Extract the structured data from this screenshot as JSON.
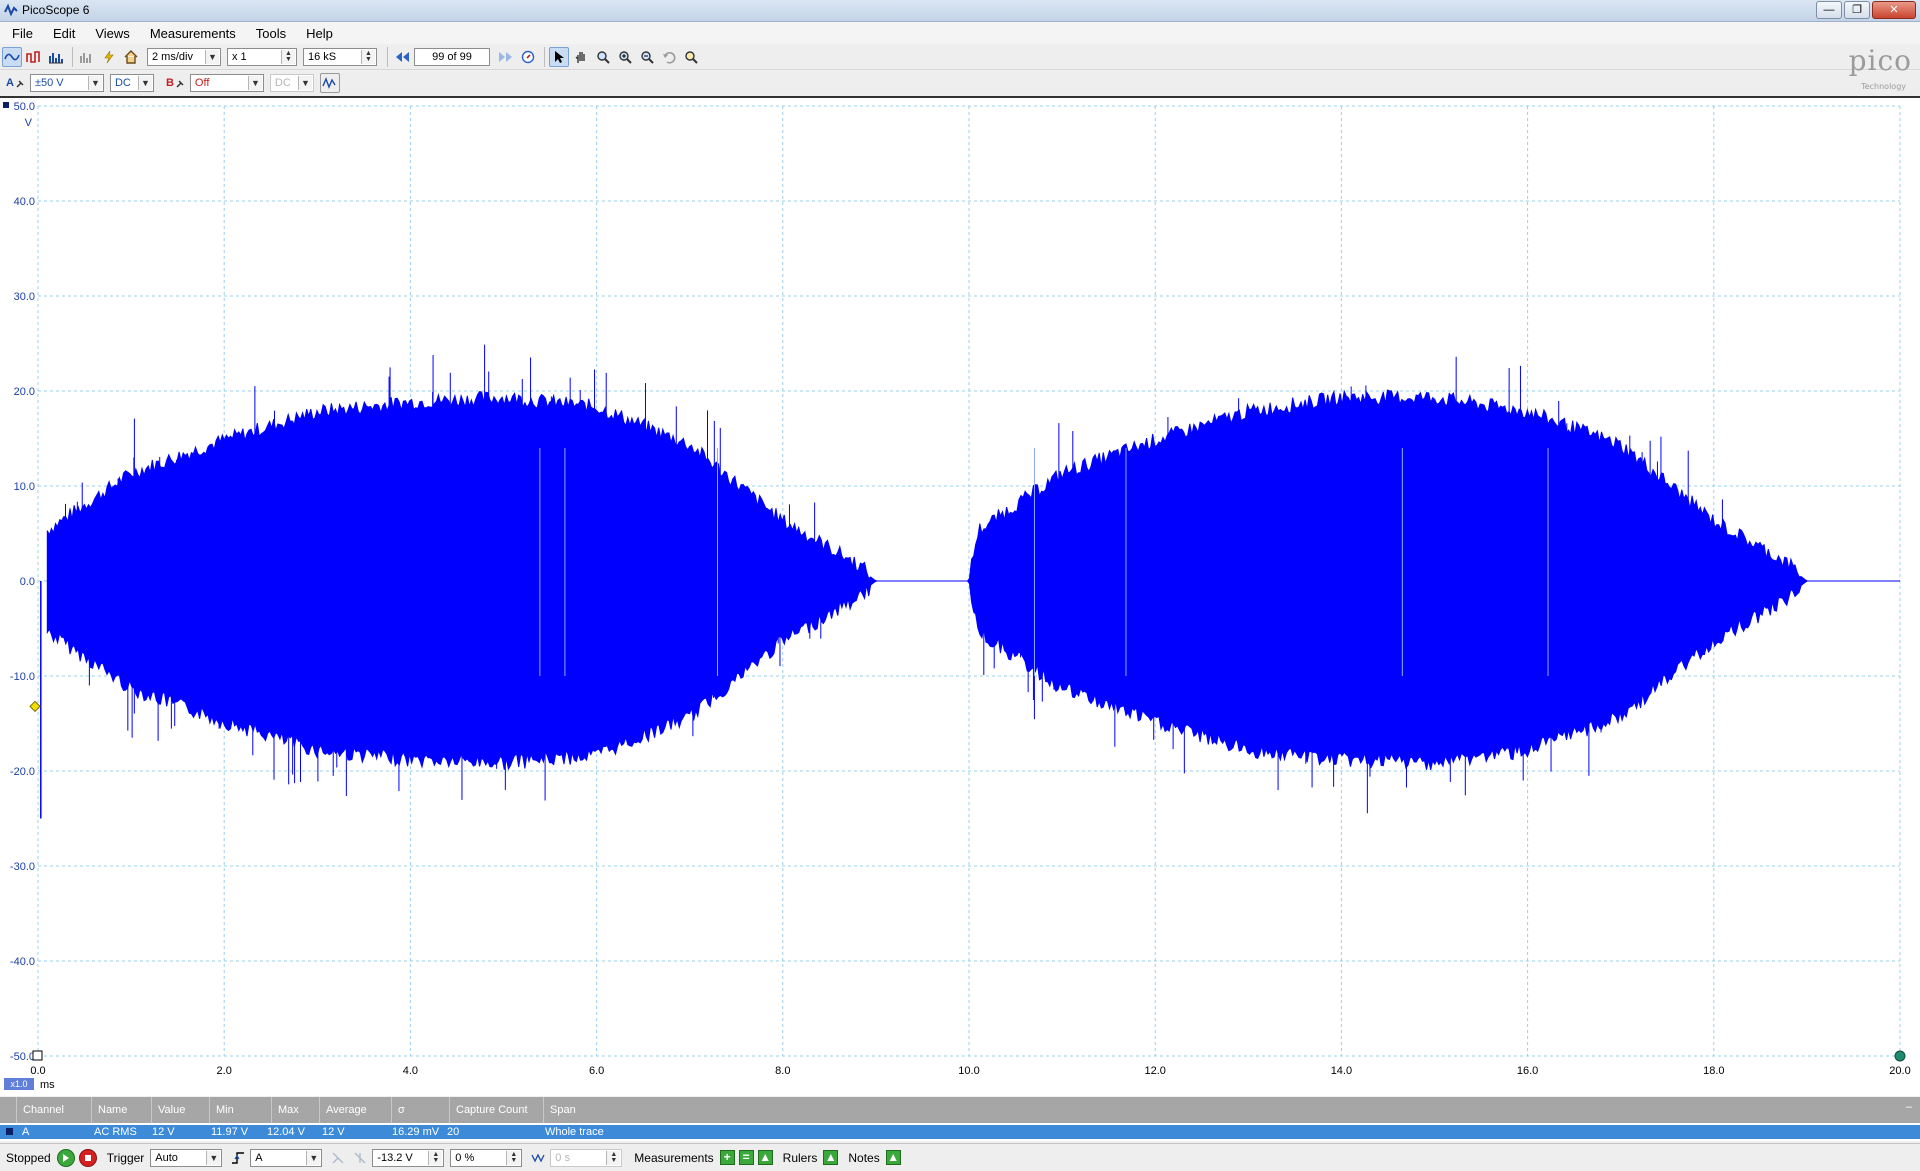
{
  "window": {
    "title": "PicoScope 6"
  },
  "menu": [
    "File",
    "Edit",
    "Views",
    "Measurements",
    "Tools",
    "Help"
  ],
  "toolbar": {
    "timebase": "2 ms/div",
    "zoom": "x 1",
    "samples": "16 kS",
    "buffer": "99 of 99"
  },
  "channels": {
    "a_label": "A",
    "a_range": "±50 V",
    "a_coupling": "DC",
    "b_label": "B",
    "b_range": "Off",
    "b_coupling": "DC"
  },
  "logo": {
    "name": "pico",
    "sub": "Technology"
  },
  "scope": {
    "y_unit": "V",
    "x_unit": "ms",
    "zoom_badge": "x1.0",
    "y_ticks": [
      "50.0",
      "40.0",
      "30.0",
      "20.0",
      "10.0",
      "0.0",
      "-10.0",
      "-20.0",
      "-30.0",
      "-40.0",
      "-50.0"
    ],
    "x_ticks": [
      "0.0",
      "2.0",
      "4.0",
      "6.0",
      "8.0",
      "10.0",
      "12.0",
      "14.0",
      "16.0",
      "18.0",
      "20.0"
    ],
    "trace_color": "#0000ff",
    "grid_color": "#9ad0ea"
  },
  "chart_data": {
    "type": "line",
    "title": "",
    "xlabel": "ms",
    "ylabel": "V",
    "xlim": [
      0,
      20
    ],
    "ylim": [
      -50,
      50
    ],
    "grid": true,
    "series": [
      {
        "name": "A",
        "description_points": "upper envelope approx",
        "x": [
          0.1,
          1.0,
          2.0,
          3.0,
          4.0,
          5.0,
          6.0,
          7.0,
          8.0,
          8.8,
          9.0,
          10.0,
          10.1,
          11.0,
          12.0,
          13.0,
          14.0,
          15.0,
          16.0,
          17.0,
          18.0,
          18.8,
          19.0,
          20.0
        ],
        "y_max": [
          5,
          11,
          14.5,
          17.5,
          18.5,
          19,
          18,
          14,
          6,
          1.5,
          0,
          0,
          5,
          11,
          14.5,
          17.5,
          19,
          19,
          17.5,
          14,
          6,
          1.5,
          0,
          0
        ],
        "y_min": [
          -5,
          -11,
          -14.5,
          -17.5,
          -18.5,
          -18.8,
          -18,
          -14,
          -6,
          -1.5,
          0,
          0,
          -5,
          -11,
          -14.5,
          -17.5,
          -18.5,
          -18.8,
          -17.5,
          -14,
          -6,
          -1.5,
          0,
          0
        ]
      }
    ]
  },
  "measurements": {
    "headers": [
      "Channel",
      "Name",
      "Value",
      "Min",
      "Max",
      "Average",
      "σ",
      "Capture Count",
      "Span"
    ],
    "row": [
      "A",
      "AC RMS",
      "12 V",
      "11.97 V",
      "12.04 V",
      "12 V",
      "16.29 mV",
      "20",
      "Whole trace"
    ]
  },
  "status": {
    "state": "Stopped",
    "trigger_label": "Trigger",
    "trigger_mode": "Auto",
    "trigger_source": "A",
    "trigger_level": "-13.2 V",
    "pre_trigger": "0 %",
    "delay": "0 s",
    "measurements_label": "Measurements",
    "rulers_label": "Rulers",
    "notes_label": "Notes"
  }
}
